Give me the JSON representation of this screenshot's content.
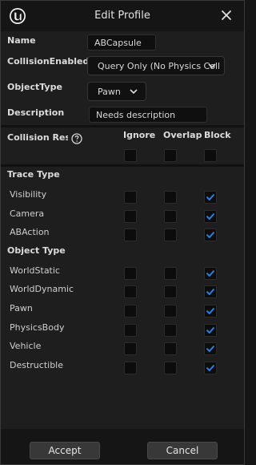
{
  "window": {
    "title": "Edit Profile"
  },
  "fields": {
    "name": {
      "label": "Name",
      "value": "ABCapsule"
    },
    "collision_enabled": {
      "label": "CollisionEnabled",
      "value": "Query Only (No Physics Coll"
    },
    "object_type": {
      "label": "ObjectType",
      "value": "Pawn"
    },
    "description": {
      "label": "Description",
      "value": "Needs description"
    }
  },
  "responses": {
    "label": "Collision Respo",
    "columns": [
      "Ignore",
      "Overlap",
      "Block"
    ]
  },
  "sections": [
    {
      "title": "Trace Type",
      "rows": [
        {
          "name": "Visibility",
          "response": "Block"
        },
        {
          "name": "Camera",
          "response": "Block"
        },
        {
          "name": "ABAction",
          "response": "Block"
        }
      ]
    },
    {
      "title": "Object Type",
      "rows": [
        {
          "name": "WorldStatic",
          "response": "Block"
        },
        {
          "name": "WorldDynamic",
          "response": "Block"
        },
        {
          "name": "Pawn",
          "response": "Block"
        },
        {
          "name": "PhysicsBody",
          "response": "Block"
        },
        {
          "name": "Vehicle",
          "response": "Block"
        },
        {
          "name": "Destructible",
          "response": "Block"
        }
      ]
    }
  ],
  "buttons": {
    "accept": "Accept",
    "cancel": "Cancel"
  },
  "colors": {
    "accent": "#2a7fe0",
    "background": "#1e1e1e"
  },
  "icons": {
    "logo": "unreal-logo-icon",
    "close": "close-icon",
    "help": "help-icon",
    "check": "check-icon",
    "chevron": "chevron-down-icon"
  }
}
